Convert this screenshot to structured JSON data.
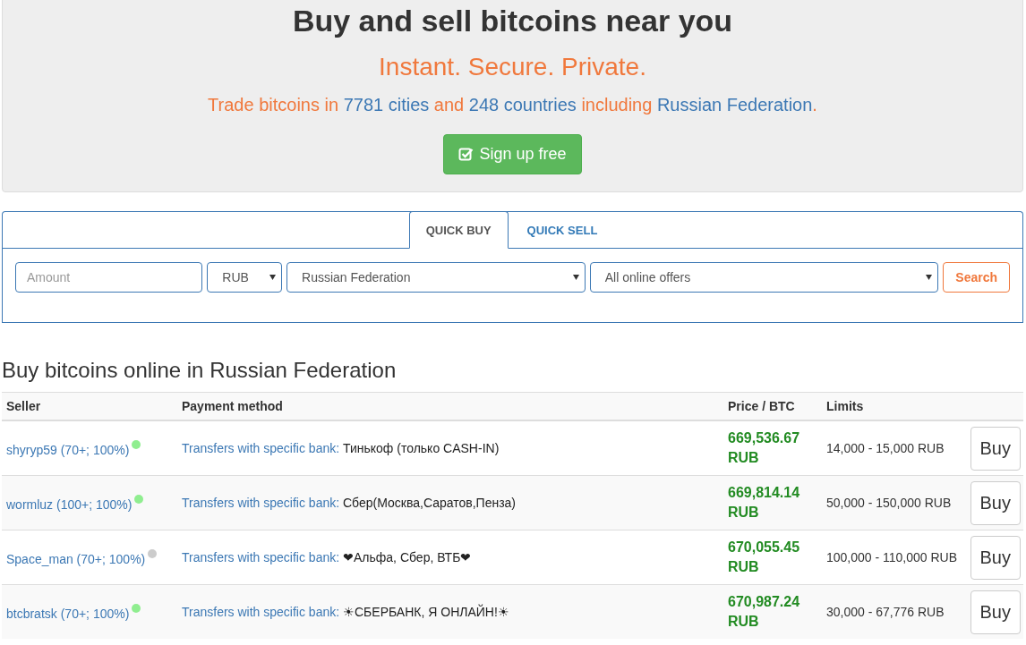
{
  "hero": {
    "title": "Buy and sell bitcoins near you",
    "tagline": "Instant. Secure. Private.",
    "subtitle": [
      {
        "kind": "plain",
        "text": "Trade bitcoins in "
      },
      {
        "kind": "highlight",
        "text": "7781 cities"
      },
      {
        "kind": "plain",
        "text": " and "
      },
      {
        "kind": "highlight",
        "text": "248 countries"
      },
      {
        "kind": "plain",
        "text": " including "
      },
      {
        "kind": "highlight",
        "text": "Russian Federation"
      },
      {
        "kind": "plain",
        "text": "."
      }
    ],
    "signup_button": "Sign up free"
  },
  "tabs": [
    {
      "label": "QUICK BUY",
      "selected": true
    },
    {
      "label": "QUICK SELL",
      "selected": false
    }
  ],
  "search_form": {
    "amount_placeholder": "Amount",
    "currency": "RUB",
    "country": "Russian Federation",
    "offers": "All online offers",
    "search_button": "Search"
  },
  "section_title": "Buy bitcoins online in Russian Federation",
  "table": {
    "columns": [
      "Seller",
      "Payment method",
      "Price / BTC",
      "Limits"
    ],
    "rows": [
      {
        "seller": "shyryp59 (70+; 100%)",
        "online": true,
        "method": "Transfers with specific bank:",
        "details": "Тинькоф (только CASH-IN)",
        "price": "669,536.67",
        "price_currency": "RUB",
        "limits": "14,000 - 15,000 RUB",
        "action": "Buy"
      },
      {
        "seller": "wormluz (100+; 100%)",
        "online": true,
        "method": "Transfers with specific bank:",
        "details": "Сбер(Москва,Саратов,Пенза)",
        "price": "669,814.14",
        "price_currency": "RUB",
        "limits": "50,000 - 150,000 RUB",
        "action": "Buy"
      },
      {
        "seller": "Space_man (70+; 100%)",
        "online": false,
        "method": "Transfers with specific bank:",
        "details": "❤Альфа, Сбер, ВТБ❤",
        "price": "670,055.45",
        "price_currency": "RUB",
        "limits": "100,000 - 110,000 RUB",
        "action": "Buy"
      },
      {
        "seller": "btcbratsk (70+; 100%)",
        "online": true,
        "method": "Transfers with specific bank:",
        "details": "☀СБЕРБАНК, Я ОНЛАЙН!☀",
        "price": "670,987.24",
        "price_currency": "RUB",
        "limits": "30,000 - 67,776 RUB",
        "action": "Buy"
      }
    ]
  }
}
